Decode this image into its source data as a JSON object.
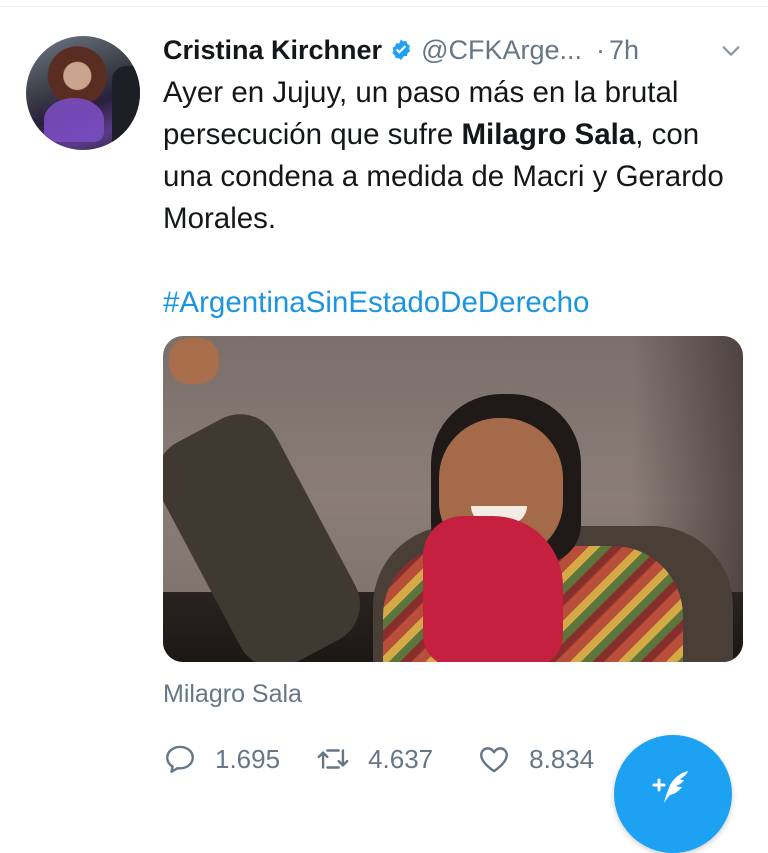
{
  "tweet": {
    "author_name": "Cristina Kirchner",
    "handle": "@CFKArge...",
    "separator": "·",
    "time": "7h",
    "text_part1": "Ayer en Jujuy, un paso más en la brutal persecución que sufre ",
    "text_bold": "Milagro Sala",
    "text_part2": ", con una condena a medida de Macri y Gerardo Morales.",
    "hashtag": "#ArgentinaSinEstadoDeDerecho",
    "media_caption": "Milagro Sala",
    "stats": {
      "replies": "1.695",
      "retweets": "4.637",
      "likes": "8.834"
    }
  },
  "icons": {
    "verified": "verified-badge-icon",
    "menu": "chevron-down-icon",
    "reply": "reply-icon",
    "retweet": "retweet-icon",
    "like": "heart-icon",
    "compose": "compose-tweet-icon"
  },
  "colors": {
    "link": "#1b95e0",
    "verified": "#1da1f2",
    "muted": "#657786",
    "fab": "#1da1f2"
  }
}
